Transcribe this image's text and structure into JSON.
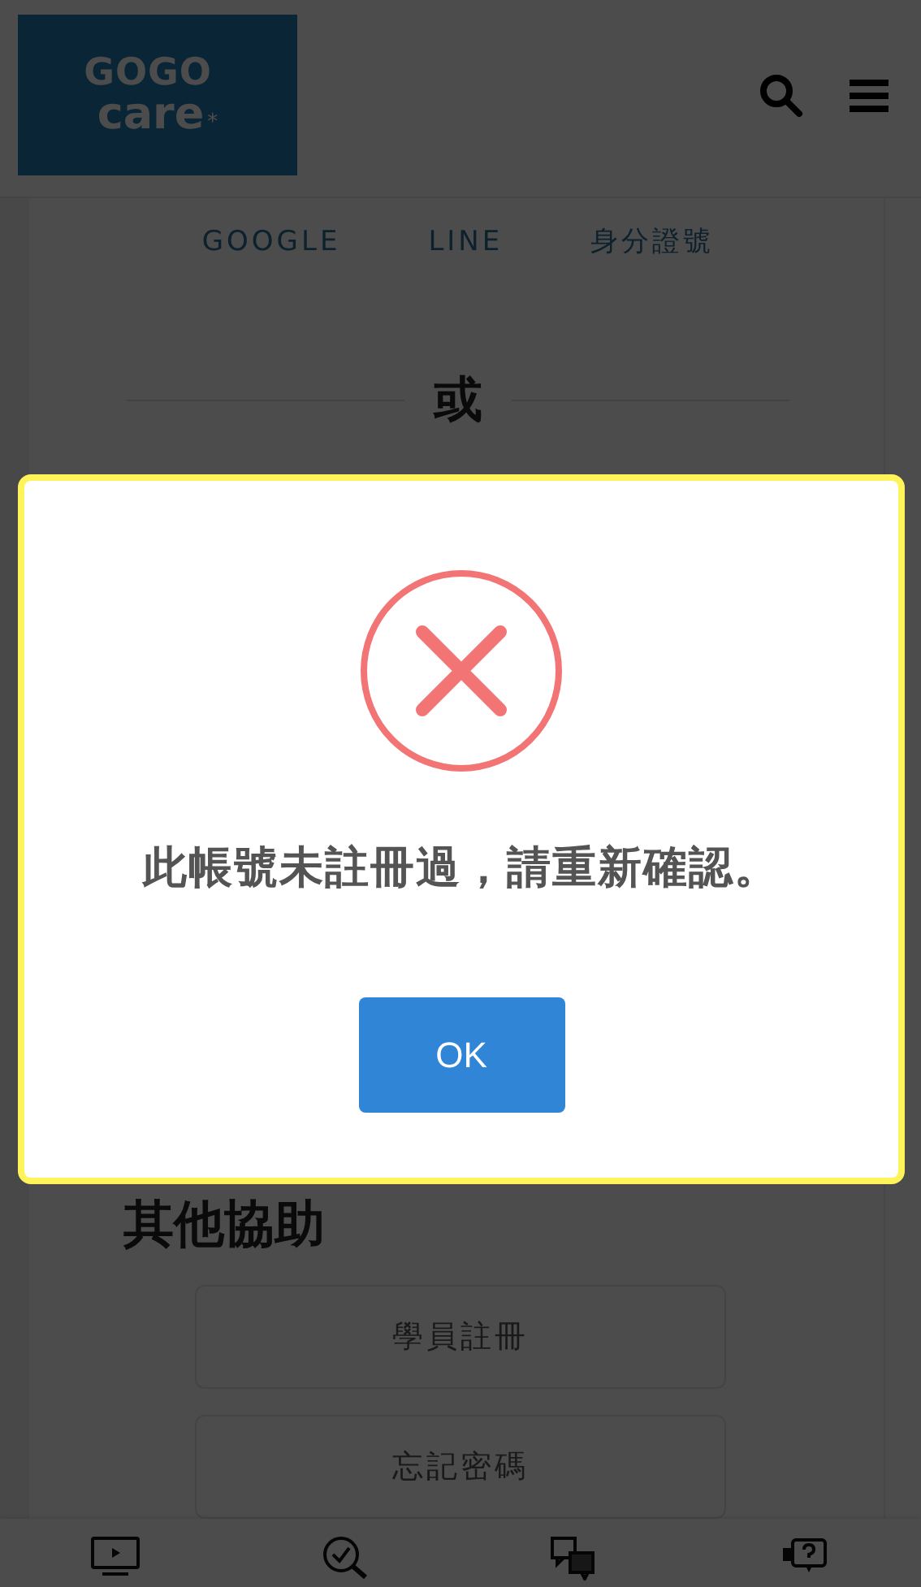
{
  "header": {
    "logo": {
      "line_1": "GOGO",
      "line_2": "care",
      "mark": "*"
    }
  },
  "login_tabs": [
    {
      "label": "GOOGLE",
      "selected": false
    },
    {
      "label": "LINE",
      "selected": false
    },
    {
      "label": "身分證號",
      "selected": false
    }
  ],
  "separator": "或",
  "help": {
    "title": "其他協助",
    "buttons": [
      "學員註冊",
      "忘記密碼"
    ]
  },
  "bottom_nav": [
    {
      "kind": "video"
    },
    {
      "kind": "search"
    },
    {
      "kind": "qa"
    },
    {
      "kind": "help"
    }
  ],
  "dialog": {
    "kind": "error",
    "message": "此帳號未註冊過，請重新確認。",
    "button": "OK"
  }
}
